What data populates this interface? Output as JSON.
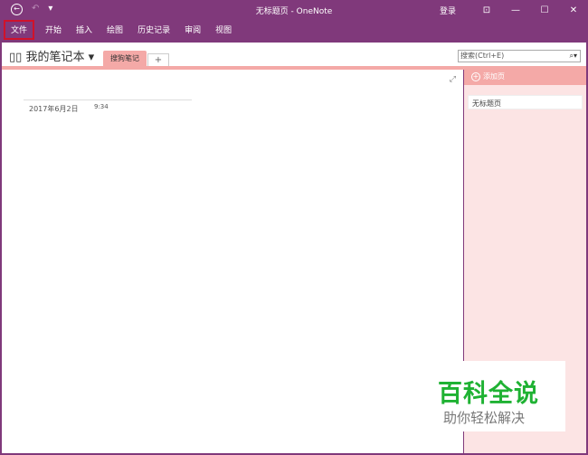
{
  "titlebar": {
    "title": "无标题页 - OneNote",
    "login": "登录",
    "back_icon": "back-icon",
    "undo": "↶",
    "qa": "▾"
  },
  "ribbon": {
    "tabs": [
      "文件",
      "开始",
      "插入",
      "绘图",
      "历史记录",
      "审阅",
      "视图"
    ]
  },
  "notebook": {
    "name": "我的笔记本 ▾",
    "section": "搜狗笔记",
    "add": "+",
    "search_placeholder": "搜索(Ctrl+E)"
  },
  "page": {
    "date": "2017年6月2日",
    "time": "9:34"
  },
  "pages_panel": {
    "add_label": "添加页",
    "items": [
      "无标题页"
    ]
  },
  "watermark": {
    "title": "百科全说",
    "subtitle": "助你轻松解决"
  },
  "colors": {
    "brand": "#80397b",
    "section": "#f4a9a7",
    "panel": "#fce4e4"
  }
}
